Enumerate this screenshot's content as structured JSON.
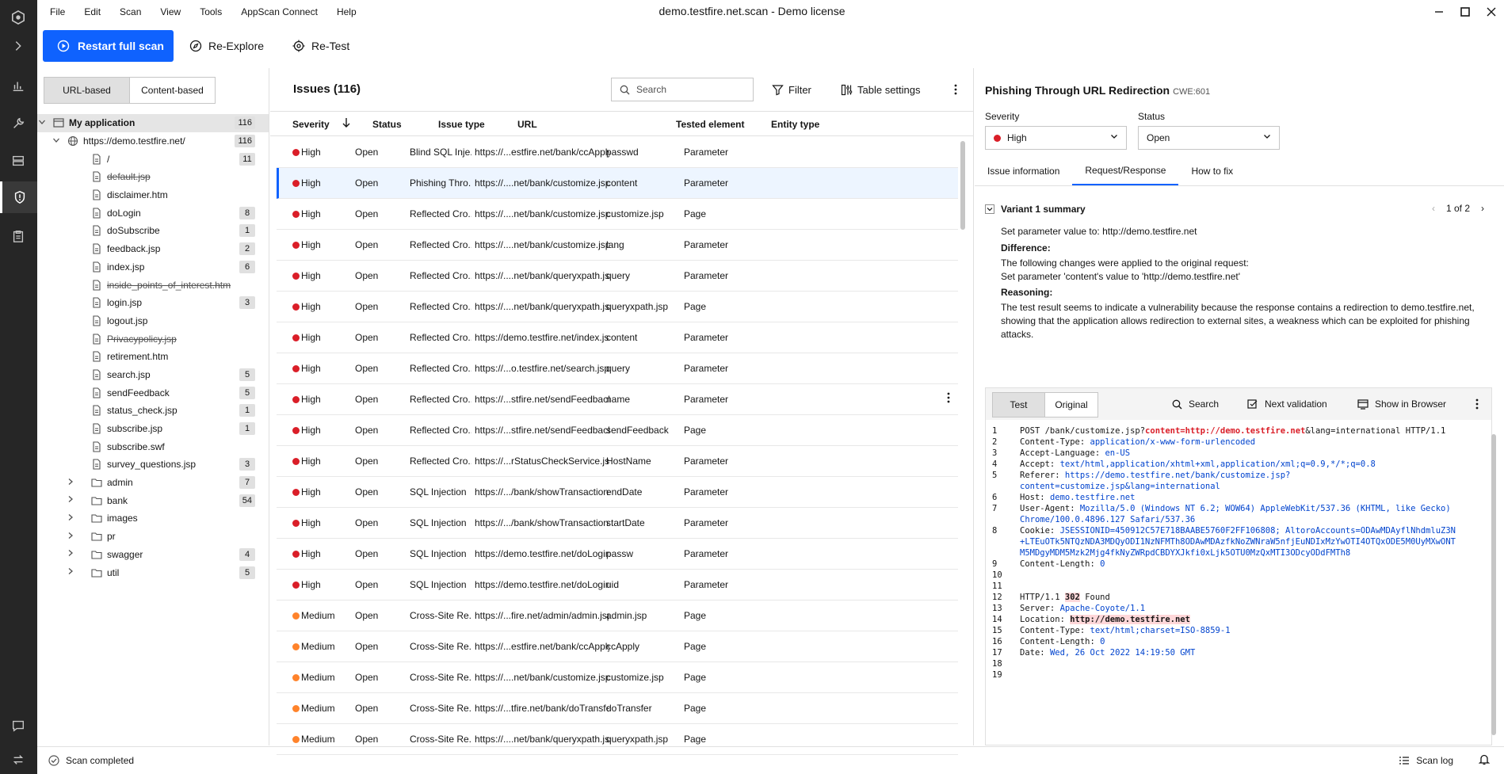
{
  "menu": [
    "File",
    "Edit",
    "Scan",
    "View",
    "Tools",
    "AppScan Connect",
    "Help"
  ],
  "window_title": "demo.testfire.net.scan - Demo license",
  "toolbar": {
    "restart": "Restart full scan",
    "reexplore": "Re-Explore",
    "retest": "Re-Test"
  },
  "tree_tabs": {
    "url": "URL-based",
    "content": "Content-based"
  },
  "tree": [
    {
      "label": "My application",
      "count": "116",
      "depth": 0,
      "type": "app",
      "chev": "open",
      "bold": true,
      "selected": true
    },
    {
      "label": "https://demo.testfire.net/",
      "count": "116",
      "depth": 1,
      "type": "globe",
      "chev": "open"
    },
    {
      "label": "/",
      "count": "11",
      "depth": 2,
      "type": "file"
    },
    {
      "label": "default.jsp",
      "count": "",
      "depth": 2,
      "type": "file",
      "strike": true
    },
    {
      "label": "disclaimer.htm",
      "count": "",
      "depth": 2,
      "type": "file"
    },
    {
      "label": "doLogin",
      "count": "8",
      "depth": 2,
      "type": "file"
    },
    {
      "label": "doSubscribe",
      "count": "1",
      "depth": 2,
      "type": "file"
    },
    {
      "label": "feedback.jsp",
      "count": "2",
      "depth": 2,
      "type": "file"
    },
    {
      "label": "index.jsp",
      "count": "6",
      "depth": 2,
      "type": "file"
    },
    {
      "label": "inside_points_of_interest.htm",
      "count": "",
      "depth": 2,
      "type": "file",
      "strike": true
    },
    {
      "label": "login.jsp",
      "count": "3",
      "depth": 2,
      "type": "file"
    },
    {
      "label": "logout.jsp",
      "count": "",
      "depth": 2,
      "type": "file"
    },
    {
      "label": "Privacypolicy.jsp",
      "count": "",
      "depth": 2,
      "type": "file",
      "strike": true
    },
    {
      "label": "retirement.htm",
      "count": "",
      "depth": 2,
      "type": "file"
    },
    {
      "label": "search.jsp",
      "count": "5",
      "depth": 2,
      "type": "file"
    },
    {
      "label": "sendFeedback",
      "count": "5",
      "depth": 2,
      "type": "file"
    },
    {
      "label": "status_check.jsp",
      "count": "1",
      "depth": 2,
      "type": "file"
    },
    {
      "label": "subscribe.jsp",
      "count": "1",
      "depth": 2,
      "type": "file"
    },
    {
      "label": "subscribe.swf",
      "count": "",
      "depth": 2,
      "type": "file"
    },
    {
      "label": "survey_questions.jsp",
      "count": "3",
      "depth": 2,
      "type": "file"
    },
    {
      "label": "admin",
      "count": "7",
      "depth": 2,
      "type": "folder",
      "chev": "closed"
    },
    {
      "label": "bank",
      "count": "54",
      "depth": 2,
      "type": "folder",
      "chev": "closed"
    },
    {
      "label": "images",
      "count": "",
      "depth": 2,
      "type": "folder",
      "chev": "closed"
    },
    {
      "label": "pr",
      "count": "",
      "depth": 2,
      "type": "folder",
      "chev": "closed"
    },
    {
      "label": "swagger",
      "count": "4",
      "depth": 2,
      "type": "folder",
      "chev": "closed"
    },
    {
      "label": "util",
      "count": "5",
      "depth": 2,
      "type": "folder",
      "chev": "closed"
    }
  ],
  "issues": {
    "title": "Issues (116)",
    "search_placeholder": "Search",
    "filter": "Filter",
    "table_settings": "Table settings",
    "columns": {
      "severity": "Severity",
      "status": "Status",
      "type": "Issue type",
      "url": "URL",
      "element": "Tested element",
      "entity": "Entity type"
    },
    "rows": [
      {
        "sev": "High",
        "status": "Open",
        "type": "Blind SQL Inje...",
        "url": "https://...estfire.net/bank/ccApply",
        "el": "passwd",
        "ent": "Parameter"
      },
      {
        "sev": "High",
        "status": "Open",
        "type": "Phishing Thro...",
        "url": "https://....net/bank/customize.jsp",
        "el": "content",
        "ent": "Parameter",
        "selected": true
      },
      {
        "sev": "High",
        "status": "Open",
        "type": "Reflected Cro...",
        "url": "https://....net/bank/customize.jsp",
        "el": "customize.jsp",
        "ent": "Page"
      },
      {
        "sev": "High",
        "status": "Open",
        "type": "Reflected Cro...",
        "url": "https://....net/bank/customize.jsp",
        "el": "lang",
        "ent": "Parameter"
      },
      {
        "sev": "High",
        "status": "Open",
        "type": "Reflected Cro...",
        "url": "https://....net/bank/queryxpath.jsp",
        "el": "query",
        "ent": "Parameter"
      },
      {
        "sev": "High",
        "status": "Open",
        "type": "Reflected Cro...",
        "url": "https://....net/bank/queryxpath.jsp",
        "el": "queryxpath.jsp",
        "ent": "Page"
      },
      {
        "sev": "High",
        "status": "Open",
        "type": "Reflected Cro...",
        "url": "https://demo.testfire.net/index.jsp",
        "el": "content",
        "ent": "Parameter"
      },
      {
        "sev": "High",
        "status": "Open",
        "type": "Reflected Cro...",
        "url": "https://...o.testfire.net/search.jsp",
        "el": "query",
        "ent": "Parameter"
      },
      {
        "sev": "High",
        "status": "Open",
        "type": "Reflected Cro...",
        "url": "https://...stfire.net/sendFeedback",
        "el": "name",
        "ent": "Parameter",
        "kebab": true
      },
      {
        "sev": "High",
        "status": "Open",
        "type": "Reflected Cro...",
        "url": "https://...stfire.net/sendFeedback",
        "el": "sendFeedback",
        "ent": "Page"
      },
      {
        "sev": "High",
        "status": "Open",
        "type": "Reflected Cro...",
        "url": "https://...rStatusCheckService.jsp",
        "el": "HostName",
        "ent": "Parameter"
      },
      {
        "sev": "High",
        "status": "Open",
        "type": "SQL Injection",
        "url": "https://.../bank/showTransactions",
        "el": "endDate",
        "ent": "Parameter"
      },
      {
        "sev": "High",
        "status": "Open",
        "type": "SQL Injection",
        "url": "https://.../bank/showTransactions",
        "el": "startDate",
        "ent": "Parameter"
      },
      {
        "sev": "High",
        "status": "Open",
        "type": "SQL Injection",
        "url": "https://demo.testfire.net/doLogin",
        "el": "passw",
        "ent": "Parameter"
      },
      {
        "sev": "High",
        "status": "Open",
        "type": "SQL Injection",
        "url": "https://demo.testfire.net/doLogin",
        "el": "uid",
        "ent": "Parameter"
      },
      {
        "sev": "Medium",
        "status": "Open",
        "type": "Cross-Site Re...",
        "url": "https://...fire.net/admin/admin.jsp",
        "el": "admin.jsp",
        "ent": "Page"
      },
      {
        "sev": "Medium",
        "status": "Open",
        "type": "Cross-Site Re...",
        "url": "https://...estfire.net/bank/ccApply",
        "el": "ccApply",
        "ent": "Page"
      },
      {
        "sev": "Medium",
        "status": "Open",
        "type": "Cross-Site Re...",
        "url": "https://....net/bank/customize.jsp",
        "el": "customize.jsp",
        "ent": "Page"
      },
      {
        "sev": "Medium",
        "status": "Open",
        "type": "Cross-Site Re...",
        "url": "https://...tfire.net/bank/doTransfer",
        "el": "doTransfer",
        "ent": "Page"
      },
      {
        "sev": "Medium",
        "status": "Open",
        "type": "Cross-Site Re...",
        "url": "https://....net/bank/queryxpath.jsp",
        "el": "queryxpath.jsp",
        "ent": "Page"
      }
    ]
  },
  "detail": {
    "title": "Phishing Through URL Redirection",
    "cwe": "CWE:601",
    "severity_label": "Severity",
    "severity_value": "High",
    "status_label": "Status",
    "status_value": "Open",
    "tabs": [
      "Issue information",
      "Request/Response",
      "How to fix"
    ],
    "variant_title": "Variant 1 summary",
    "variant_pager": "1 of 2",
    "summary_line": "Set parameter value to: http://demo.testfire.net",
    "difference_label": "Difference:",
    "difference_line1": "The following changes were applied to the original request:",
    "difference_line2": "Set parameter 'content's value to 'http://demo.testfire.net'",
    "reasoning_label": "Reasoning:",
    "reasoning_text": "The test result seems to indicate a vulnerability because the response contains a redirection to demo.testfire.net, showing that the application allows redirection to external sites, a weakness which can be exploited for phishing attacks.",
    "req_tabs": [
      "Test",
      "Original"
    ],
    "req_search": "Search",
    "next_validation": "Next validation",
    "show_browser": "Show in Browser"
  },
  "code": [
    {
      "n": "1",
      "parts": [
        [
          "k",
          "POST /bank/customize.jsp?"
        ],
        [
          "hl",
          "content=http://demo.testfire.net"
        ],
        [
          "k",
          "&lang=international HTTP/1.1"
        ]
      ]
    },
    {
      "n": "2",
      "parts": [
        [
          "k",
          "Content-Type: "
        ],
        [
          "v",
          "application/x-www-form-urlencoded"
        ]
      ]
    },
    {
      "n": "3",
      "parts": [
        [
          "k",
          "Accept-Language: "
        ],
        [
          "v",
          "en-US"
        ]
      ]
    },
    {
      "n": "4",
      "parts": [
        [
          "k",
          "Accept: "
        ],
        [
          "v",
          "text/html,application/xhtml+xml,application/xml;q=0.9,*/*;q=0.8"
        ]
      ]
    },
    {
      "n": "5",
      "parts": [
        [
          "k",
          "Referer: "
        ],
        [
          "v",
          "https://demo.testfire.net/bank/customize.jsp?"
        ]
      ]
    },
    {
      "n": "",
      "parts": [
        [
          "v",
          "content=customize.jsp&lang=international"
        ]
      ]
    },
    {
      "n": "6",
      "parts": [
        [
          "k",
          "Host: "
        ],
        [
          "v",
          "demo.testfire.net"
        ]
      ]
    },
    {
      "n": "7",
      "parts": [
        [
          "k",
          "User-Agent: "
        ],
        [
          "v",
          "Mozilla/5.0 (Windows NT 6.2; WOW64) AppleWebKit/537.36 (KHTML, like Gecko)"
        ]
      ]
    },
    {
      "n": "",
      "parts": [
        [
          "v",
          "Chrome/100.0.4896.127 Safari/537.36"
        ]
      ]
    },
    {
      "n": "8",
      "parts": [
        [
          "k",
          "Cookie: "
        ],
        [
          "v",
          "JSESSIONID=450912C57E718BAABE5760F2FF106808; AltoroAccounts=ODAwMDAyflNhdmluZ3N"
        ]
      ]
    },
    {
      "n": "",
      "parts": [
        [
          "v",
          "+LTEuOTk5NTQzNDA3MDQyODI1NzNFMTh8ODAwMDAzfkNoZWNraW5nfjEuNDIxMzYwOTI4OTQxODE5M0UyMXwONT"
        ]
      ]
    },
    {
      "n": "",
      "parts": [
        [
          "v",
          "M5MDgyMDM5Mzk2Mjg4fkNyZWRpdCBDYXJkfi0xLjk5OTU0MzQxMTI3ODcyODdFMTh8"
        ]
      ]
    },
    {
      "n": "9",
      "parts": [
        [
          "k",
          "Content-Length: "
        ],
        [
          "v",
          "0"
        ]
      ]
    },
    {
      "n": "10",
      "parts": []
    },
    {
      "n": "11",
      "parts": []
    },
    {
      "n": "12",
      "parts": [
        [
          "k",
          "HTTP/1.1 "
        ],
        [
          "hb",
          "302"
        ],
        [
          "k",
          " Found"
        ]
      ]
    },
    {
      "n": "13",
      "parts": [
        [
          "k",
          "Server: "
        ],
        [
          "v",
          "Apache-Coyote/1.1"
        ]
      ]
    },
    {
      "n": "14",
      "parts": [
        [
          "k",
          "Location: "
        ],
        [
          "hb",
          "http://demo.testfire.net"
        ]
      ]
    },
    {
      "n": "15",
      "parts": [
        [
          "k",
          "Content-Type: "
        ],
        [
          "v",
          "text/html;charset=ISO-8859-1"
        ]
      ]
    },
    {
      "n": "16",
      "parts": [
        [
          "k",
          "Content-Length: "
        ],
        [
          "v",
          "0"
        ]
      ]
    },
    {
      "n": "17",
      "parts": [
        [
          "k",
          "Date: "
        ],
        [
          "v",
          "Wed, 26 Oct 2022 14:19:50 GMT"
        ]
      ]
    },
    {
      "n": "18",
      "parts": []
    },
    {
      "n": "19",
      "parts": []
    }
  ],
  "status": {
    "text": "Scan completed",
    "scan_log": "Scan log"
  },
  "colors": {
    "accent": "#0f62fe",
    "high": "#da1e28",
    "medium": "#ff832b"
  }
}
